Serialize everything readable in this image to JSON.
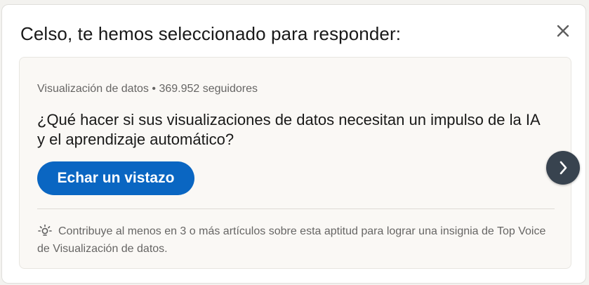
{
  "dialog": {
    "title": "Celso, te hemos seleccionado para responder:",
    "close_icon": "close-icon"
  },
  "article": {
    "topic": "Visualización de datos",
    "separator": "•",
    "followers": "369.952 seguidores",
    "question": "¿Qué hacer si sus visualizaciones de datos necesitan un impulso de la IA y el aprendizaje automático?",
    "cta_label": "Echar un vistazo",
    "tip_icon": "lightbulb-icon",
    "tip_text": "Contribuye al menos en 3 o más artículos sobre esta aptitud para lograr una insignia de Top Voice de Visualización de datos."
  },
  "navigation": {
    "next_icon": "chevron-right-icon"
  },
  "colors": {
    "accent": "#0a66c2",
    "card_background": "#faf8f5",
    "next_button": "#38434f"
  }
}
